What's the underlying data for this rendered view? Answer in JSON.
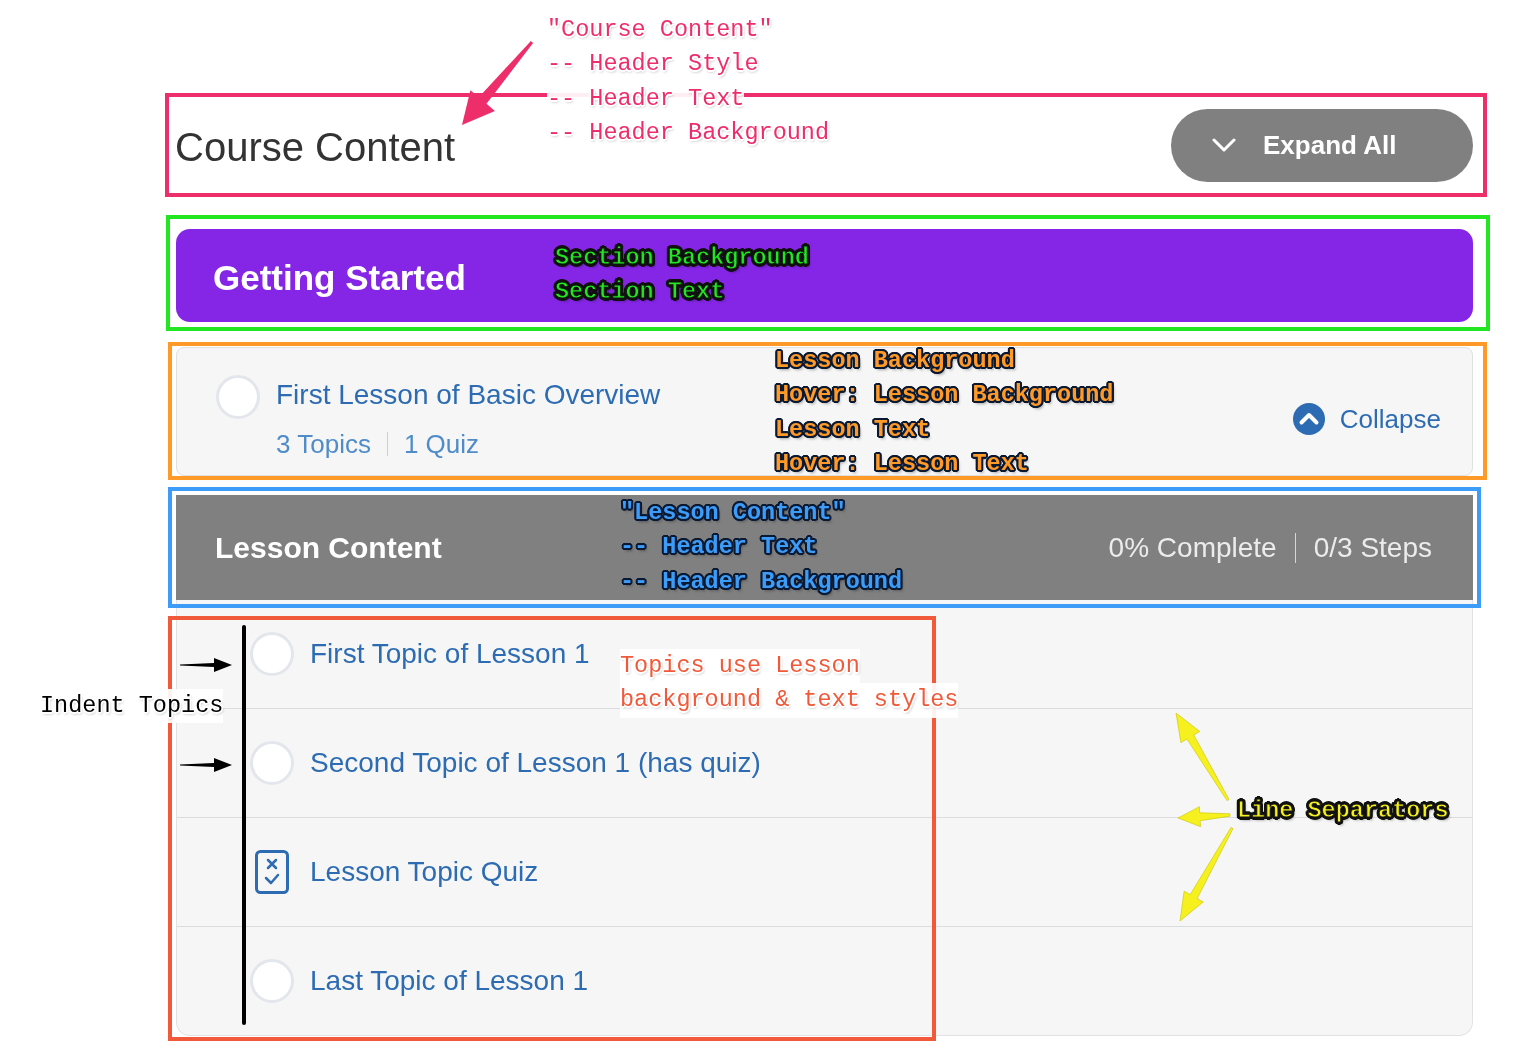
{
  "course_header": {
    "title": "Course Content",
    "expand_button": {
      "label": "Expand All"
    }
  },
  "section": {
    "title": "Getting Started"
  },
  "lesson": {
    "title": "First Lesson of Basic Overview",
    "completed": false,
    "meta": [
      "3 Topics",
      "1 Quiz"
    ],
    "toggle": {
      "label": "Collapse",
      "expanded": true
    }
  },
  "lesson_content": {
    "title": "Lesson Content",
    "progress": "0% Complete",
    "steps": "0/3 Steps"
  },
  "topics": [
    {
      "kind": "topic",
      "title": "First Topic of Lesson 1",
      "completed": false
    },
    {
      "kind": "topic",
      "title": "Second Topic of Lesson 1 (has quiz)",
      "completed": false
    },
    {
      "kind": "quiz",
      "title": "Lesson Topic Quiz"
    },
    {
      "kind": "topic",
      "title": "Last Topic of Lesson 1",
      "completed": false
    }
  ],
  "annotations": [
    {
      "kind": "plain",
      "color": "#ee2d6b",
      "lines": [
        "\"Course Content\"",
        "-- Header Style",
        "-- Header Text",
        "-- Header Background"
      ]
    },
    {
      "kind": "outlined",
      "color": "#22e622",
      "lines": [
        "Section Background",
        "Section Text"
      ]
    },
    {
      "kind": "outlined",
      "color": "#ff9a28",
      "lines": [
        "Lesson Background",
        "Hover: Lesson Background",
        "Lesson Text",
        "Hover: Lesson Text"
      ]
    },
    {
      "kind": "outlined",
      "color": "#3d9cf8",
      "lines": [
        "\"Lesson Content\"",
        "-- Header Text",
        "-- Header Background"
      ]
    },
    {
      "kind": "plain",
      "color": "#000000",
      "lines": [
        "Indent Topics"
      ]
    },
    {
      "kind": "plain",
      "color": "#f05a3a",
      "lines": [
        "Topics use Lesson",
        "background & text styles"
      ]
    },
    {
      "kind": "outlined",
      "color": "#f5f01e",
      "lines": [
        "Line Separators"
      ]
    }
  ]
}
